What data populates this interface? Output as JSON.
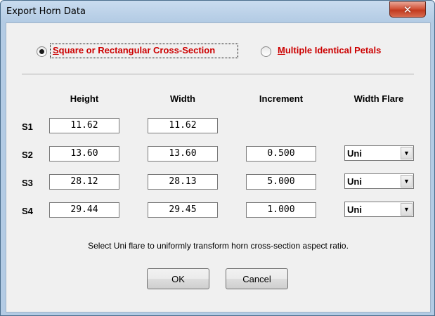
{
  "window": {
    "title": "Export Horn Data",
    "close_label": "✕"
  },
  "options": {
    "square": {
      "label": "Square or Rectangular Cross-Section",
      "mnemonic": "S",
      "rest": "quare or Rectangular Cross-Section",
      "selected": true
    },
    "petals": {
      "label": "Multiple Identical Petals",
      "mnemonic": "M",
      "rest": "ultiple Identical Petals",
      "selected": false
    }
  },
  "table": {
    "headers": {
      "height": "Height",
      "width": "Width",
      "increment": "Increment",
      "flare": "Width Flare"
    },
    "rows": [
      {
        "label": "S1",
        "height": "11.62",
        "width": "11.62"
      },
      {
        "label": "S2",
        "height": "13.60",
        "width": "13.60",
        "increment": "0.500",
        "flare": "Uni"
      },
      {
        "label": "S3",
        "height": "28.12",
        "width": "28.13",
        "increment": "5.000",
        "flare": "Uni"
      },
      {
        "label": "S4",
        "height": "29.44",
        "width": "29.45",
        "increment": "1.000",
        "flare": "Uni"
      }
    ]
  },
  "hint": "Select Uni flare to uniformly transform horn cross-section aspect ratio.",
  "buttons": {
    "ok": "OK",
    "cancel": "Cancel"
  },
  "colors": {
    "radio_label": "#cc0000",
    "close_button": "#c23a1f"
  }
}
